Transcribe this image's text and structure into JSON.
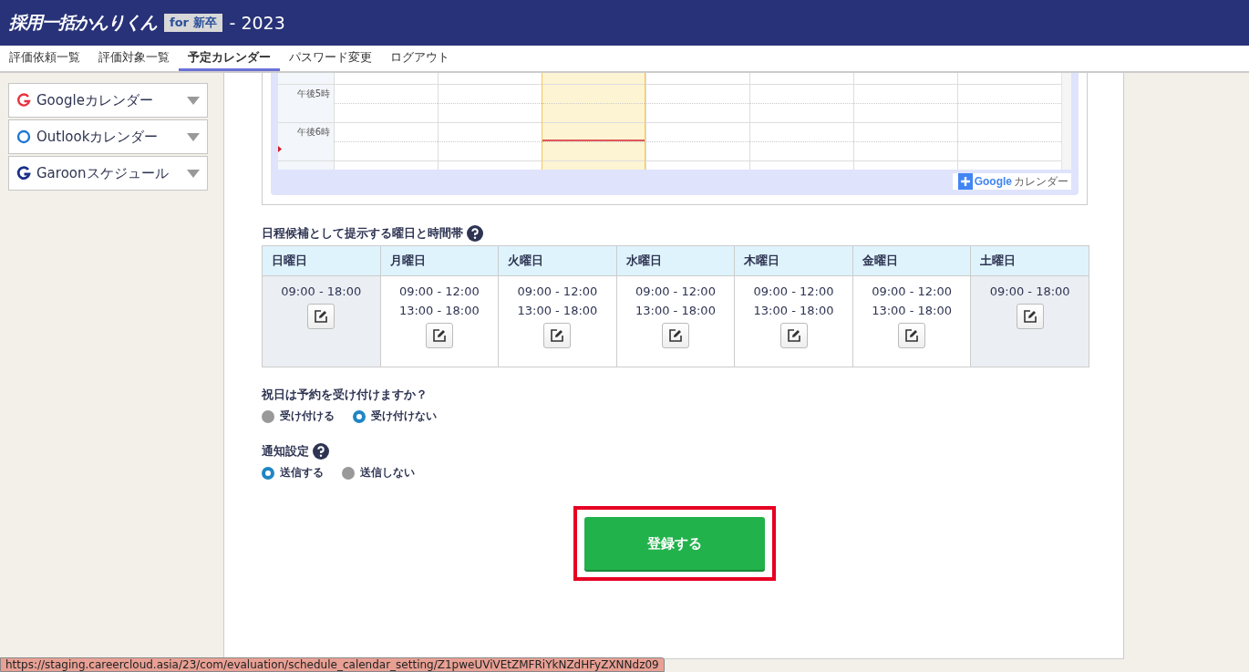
{
  "header": {
    "logo_main": "採用一括かんりくん",
    "logo_tag": "for 新卒",
    "suffix": "- 2023"
  },
  "nav": [
    {
      "label": "評価依頼一覧",
      "selected": false
    },
    {
      "label": "評価対象一覧",
      "selected": false
    },
    {
      "label": "予定カレンダー",
      "selected": true
    },
    {
      "label": "パスワード変更",
      "selected": false
    },
    {
      "label": "ログアウト",
      "selected": false
    }
  ],
  "sidebar": [
    {
      "kind": "google",
      "label": "Googleカレンダー"
    },
    {
      "kind": "outlook",
      "label": "Outlookカレンダー"
    },
    {
      "kind": "garoon",
      "label": "Garoonスケジュール"
    }
  ],
  "calendar": {
    "rows": [
      {
        "time": ""
      },
      {
        "time": "午後5時"
      },
      {
        "time": "午後6時"
      }
    ],
    "columns": [
      {
        "today": false
      },
      {
        "today": false
      },
      {
        "today": true
      },
      {
        "today": false
      },
      {
        "today": false
      },
      {
        "today": false
      },
      {
        "today": false
      }
    ],
    "add_button": {
      "brand": "Google",
      "label": "カレンダー"
    }
  },
  "schedule": {
    "title": "日程候補として提示する曜日と時間帯",
    "days": [
      {
        "name": "日曜日",
        "shaded": true,
        "slots": [
          "09:00 - 18:00"
        ]
      },
      {
        "name": "月曜日",
        "shaded": false,
        "slots": [
          "09:00 - 12:00",
          "13:00 - 18:00"
        ]
      },
      {
        "name": "火曜日",
        "shaded": false,
        "slots": [
          "09:00 - 12:00",
          "13:00 - 18:00"
        ]
      },
      {
        "name": "水曜日",
        "shaded": false,
        "slots": [
          "09:00 - 12:00",
          "13:00 - 18:00"
        ]
      },
      {
        "name": "木曜日",
        "shaded": false,
        "slots": [
          "09:00 - 12:00",
          "13:00 - 18:00"
        ]
      },
      {
        "name": "金曜日",
        "shaded": false,
        "slots": [
          "09:00 - 12:00",
          "13:00 - 18:00"
        ]
      },
      {
        "name": "土曜日",
        "shaded": true,
        "slots": [
          "09:00 - 18:00"
        ]
      }
    ]
  },
  "holidays": {
    "title": "祝日は予約を受け付けますか？",
    "help": false,
    "options": [
      {
        "label": "受け付ける",
        "selected": false
      },
      {
        "label": "受け付けない",
        "selected": true
      }
    ]
  },
  "notification": {
    "title": "通知設定",
    "help": true,
    "options": [
      {
        "label": "送信する",
        "selected": true
      },
      {
        "label": "送信しない",
        "selected": false
      }
    ]
  },
  "submit": {
    "label": "登録する",
    "highlighted": true
  },
  "status_bar": {
    "url": "https://staging.careercloud.asia/23/com/evaluation/schedule_calendar_setting/Z1pweUViVEtZMFRiYkNZdHFyZXNNdz09"
  }
}
